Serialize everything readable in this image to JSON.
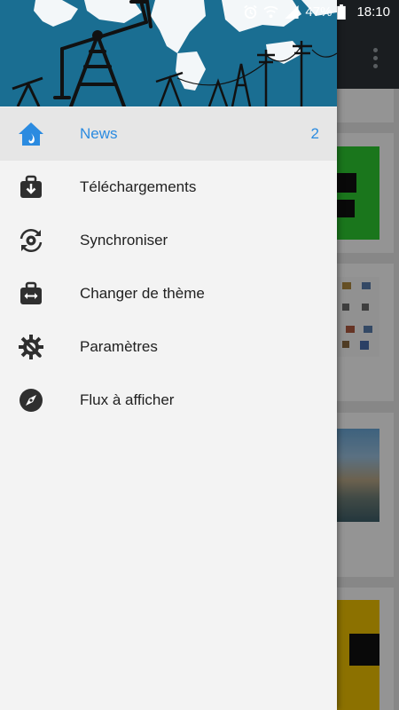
{
  "status_bar": {
    "battery": "47%",
    "time": "18:10"
  },
  "drawer": {
    "menu": [
      {
        "label": "News",
        "count": "2",
        "icon": "home-icon",
        "active": true
      },
      {
        "label": "Téléchargements",
        "icon": "download-box-icon"
      },
      {
        "label": "Synchroniser",
        "icon": "sync-gear-icon"
      },
      {
        "label": "Changer de thème",
        "icon": "swap-briefcase-icon"
      },
      {
        "label": "Paramètres",
        "icon": "settings-wrench-icon"
      },
      {
        "label": "Flux à afficher",
        "icon": "compass-icon"
      }
    ]
  },
  "colors": {
    "accent": "#2b8be0",
    "header_bg": "#1a6e92",
    "toolbar_bg": "#2e3338"
  }
}
